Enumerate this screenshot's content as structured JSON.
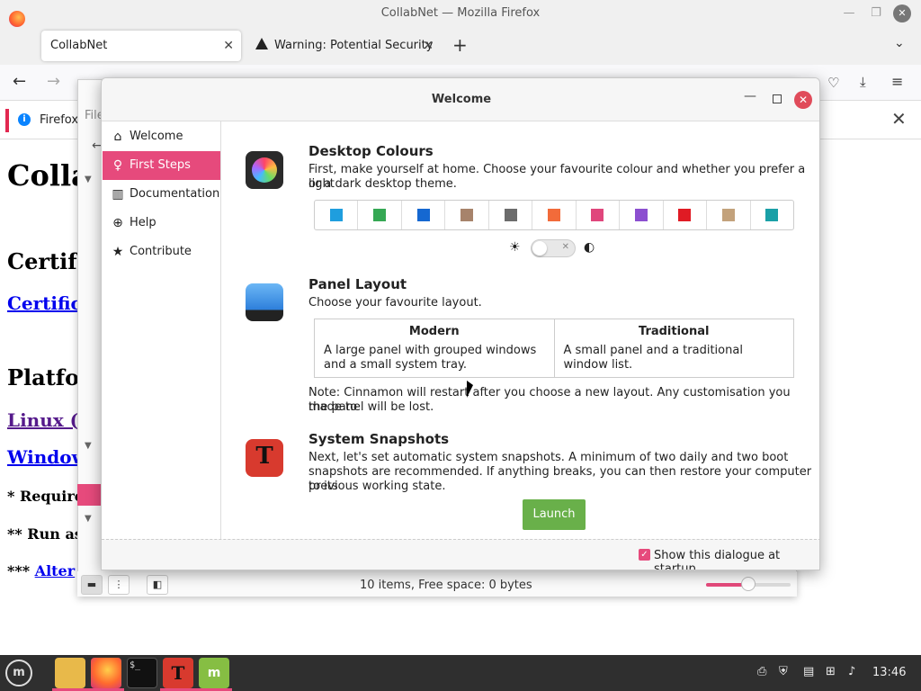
{
  "firefox": {
    "window_title": "CollabNet — Mozilla Firefox",
    "tabs": [
      {
        "label": "CollabNet"
      },
      {
        "label": "Warning: Potential Security"
      }
    ],
    "notification": "Firefox"
  },
  "page": {
    "h1": "Colla",
    "h2_cert": "Certif",
    "link_cert": "Certific",
    "h2_platform": "Platfo",
    "link_linux": "Linux (s",
    "link_windows": "Window",
    "req": "* Require",
    "run": "** Run as",
    "alt_prefix": "*** ",
    "alt_link": "Alter"
  },
  "file_manager": {
    "menu_fragment": "File",
    "status": "10 items, Free space: 0 bytes",
    "zoom": 0.5
  },
  "dialog": {
    "title": "Welcome",
    "sidebar": [
      {
        "label": "Welcome",
        "icon": "home-icon"
      },
      {
        "label": "First Steps",
        "icon": "lightbulb-icon"
      },
      {
        "label": "Documentation",
        "icon": "book-icon"
      },
      {
        "label": "Help",
        "icon": "lifebuoy-icon"
      },
      {
        "label": "Contribute",
        "icon": "star-icon"
      }
    ],
    "colours": {
      "title": "Desktop Colours",
      "text1": "First, make yourself at home. Choose your favourite colour and whether you prefer a light",
      "text2": "or a dark desktop theme.",
      "swatches": [
        "#1f9ede",
        "#35a854",
        "#1568d1",
        "#a7836b",
        "#6c6c6c",
        "#f26b3a",
        "#e0467c",
        "#8c4fd0",
        "#e01b24",
        "#c3a27c",
        "#1aa0a7"
      ]
    },
    "layout": {
      "title": "Panel Layout",
      "text": "Choose your favourite layout.",
      "modern_title": "Modern",
      "modern_desc": "A large panel with grouped windows and a small system tray.",
      "traditional_title": "Traditional",
      "traditional_desc": "A small panel and a traditional window list.",
      "note1": "Note: Cinnamon will restart after you choose a new layout. Any customisation you made to",
      "note2": "the panel will be lost."
    },
    "snapshots": {
      "title": "System Snapshots",
      "text1": "Next, let's set automatic system snapshots. A minimum of two daily and two boot",
      "text2": "snapshots are recommended. If anything breaks, you can then restore your computer to its",
      "text3": "previous working state.",
      "button": "Launch"
    },
    "footer_checkbox": "Show this dialogue at startup"
  },
  "taskbar": {
    "clock": "13:46"
  },
  "colors": {
    "accent": "#e64a7c",
    "launch": "#69b04a"
  }
}
